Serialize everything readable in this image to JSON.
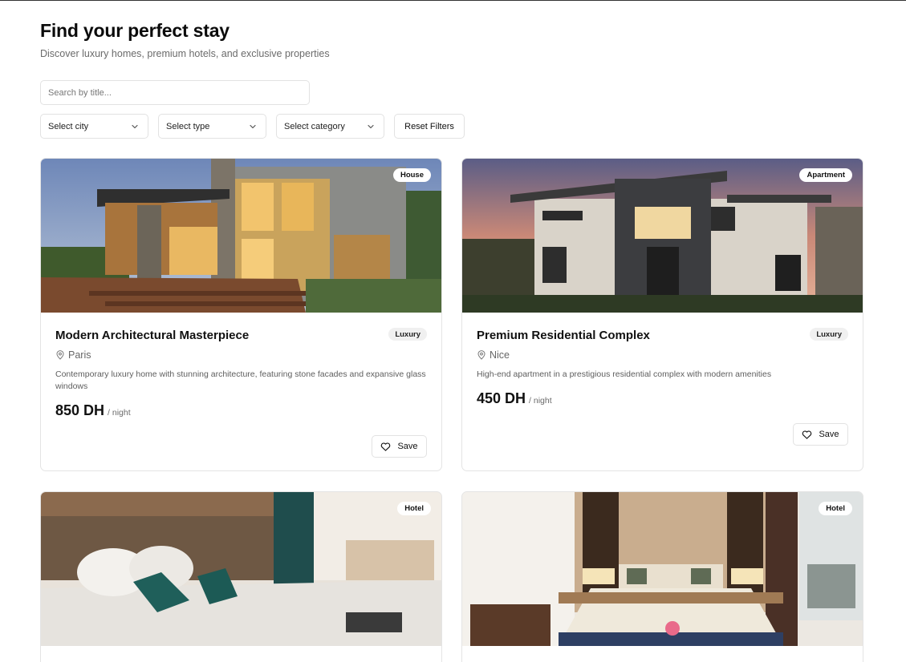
{
  "header": {
    "title": "Find your perfect stay",
    "subtitle": "Discover luxury homes, premium hotels, and exclusive properties"
  },
  "search": {
    "placeholder": "Search by title...",
    "value": ""
  },
  "filters": {
    "city": "Select city",
    "type": "Select type",
    "category": "Select category",
    "reset_label": "Reset Filters"
  },
  "listings": [
    {
      "type": "House",
      "title": "Modern Architectural Masterpiece",
      "category": "Luxury",
      "city": "Paris",
      "description": "Contemporary luxury home with stunning architecture, featuring stone facades and expansive glass windows",
      "price": "850 DH",
      "unit": "/ night",
      "save_label": "Save"
    },
    {
      "type": "Apartment",
      "title": "Premium Residential Complex",
      "category": "Luxury",
      "city": "Nice",
      "description": "High-end apartment in a prestigious residential complex with modern amenities",
      "price": "450 DH",
      "unit": "/ night",
      "save_label": "Save"
    },
    {
      "type": "Hotel"
    },
    {
      "type": "Hotel"
    }
  ],
  "icons": {
    "chevron": "chevron-down-icon",
    "pin": "map-pin-icon",
    "heart": "heart-icon"
  }
}
